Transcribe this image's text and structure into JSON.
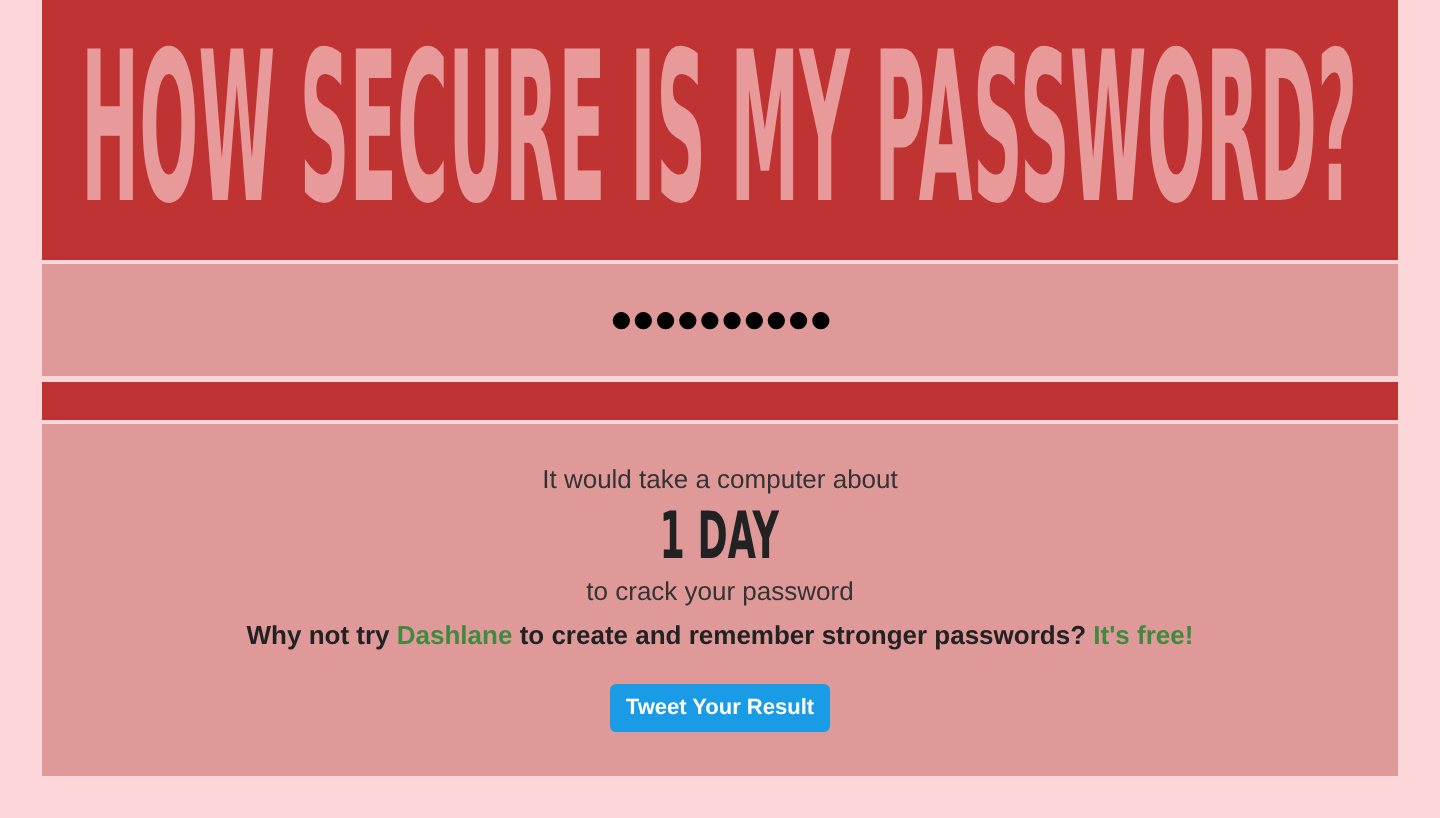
{
  "title": "HOW SECURE IS MY PASSWORD?",
  "password_field": {
    "value": "●●●●●●●●●●"
  },
  "result": {
    "intro": "It would take a computer about",
    "time": "1 DAY",
    "outro": "to crack your password",
    "promo": [
      {
        "kind": "plain",
        "text": "Why not try "
      },
      {
        "kind": "link",
        "text": "Dashlane"
      },
      {
        "kind": "plain",
        "text": " to create and remember stronger passwords? "
      },
      {
        "kind": "link",
        "text": "It's free!"
      }
    ],
    "button": "Tweet Your Result"
  }
}
